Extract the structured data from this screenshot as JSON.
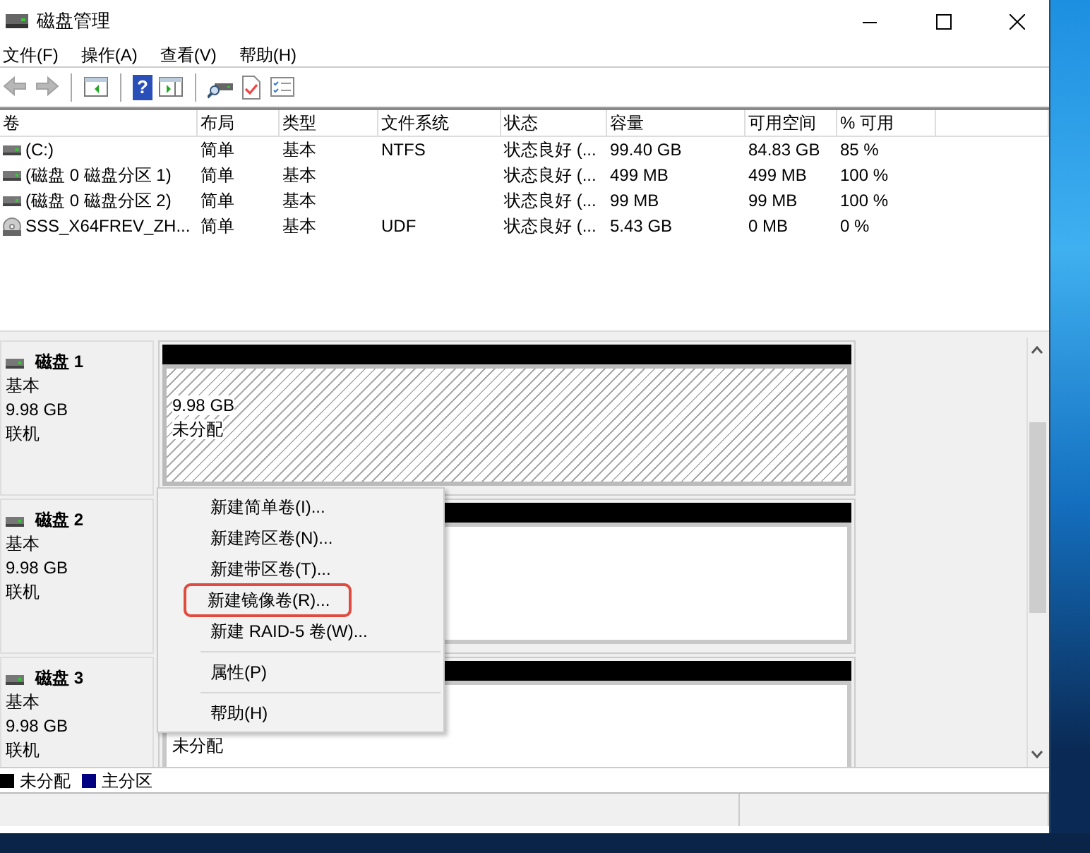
{
  "window": {
    "title": "磁盘管理"
  },
  "menu_bar": [
    "文件(F)",
    "操作(A)",
    "查看(V)",
    "帮助(H)"
  ],
  "toolbar": [
    {
      "kind": "back",
      "disabled": true
    },
    {
      "kind": "forward",
      "disabled": true
    },
    {
      "kind": "separator"
    },
    {
      "kind": "tree"
    },
    {
      "kind": "separator"
    },
    {
      "kind": "help",
      "glyph": "?"
    },
    {
      "kind": "pane"
    },
    {
      "kind": "separator"
    },
    {
      "kind": "connect"
    },
    {
      "kind": "doc"
    },
    {
      "kind": "list"
    }
  ],
  "volumes": {
    "columns": [
      "卷",
      "布局",
      "类型",
      "文件系统",
      "状态",
      "容量",
      "可用空间",
      "% 可用"
    ],
    "rows": [
      {
        "kind": "drive",
        "cells": [
          "(C:)",
          "简单",
          "基本",
          "NTFS",
          "状态良好 (...",
          "99.40 GB",
          "84.83 GB",
          "85 %"
        ]
      },
      {
        "kind": "drive",
        "cells": [
          "(磁盘 0 磁盘分区 1)",
          "简单",
          "基本",
          "",
          "状态良好 (...",
          "499 MB",
          "499 MB",
          "100 %"
        ]
      },
      {
        "kind": "drive",
        "cells": [
          "(磁盘 0 磁盘分区 2)",
          "简单",
          "基本",
          "",
          "状态良好 (...",
          "99 MB",
          "99 MB",
          "100 %"
        ]
      },
      {
        "kind": "disc",
        "cells": [
          "SSS_X64FREV_ZH...",
          "简单",
          "基本",
          "UDF",
          "状态良好 (...",
          "5.43 GB",
          "0 MB",
          "0 %"
        ]
      }
    ]
  },
  "disks": [
    {
      "name": "磁盘 1",
      "type": "基本",
      "size": "9.98 GB",
      "status": "联机",
      "partition": {
        "size": "9.98 GB",
        "label": "未分配",
        "selected": true
      }
    },
    {
      "name": "磁盘 2",
      "type": "基本",
      "size": "9.98 GB",
      "status": "联机",
      "partition": {
        "selected": false
      }
    },
    {
      "name": "磁盘 3",
      "type": "基本",
      "size": "9.98 GB",
      "status": "联机",
      "partition": {
        "label": "未分配",
        "selected": false
      }
    }
  ],
  "context_menu": [
    {
      "kind": "item",
      "label": "新建简单卷(I)...",
      "highlighted": false
    },
    {
      "kind": "item",
      "label": "新建跨区卷(N)...",
      "highlighted": false
    },
    {
      "kind": "item",
      "label": "新建带区卷(T)...",
      "highlighted": false
    },
    {
      "kind": "item",
      "label": "新建镜像卷(R)...",
      "highlighted": true
    },
    {
      "kind": "item",
      "label": "新建 RAID-5 卷(W)...",
      "highlighted": false
    },
    {
      "kind": "separator"
    },
    {
      "kind": "item",
      "label": "属性(P)",
      "highlighted": false
    },
    {
      "kind": "separator"
    },
    {
      "kind": "item",
      "label": "帮助(H)",
      "highlighted": false
    }
  ],
  "legend": [
    {
      "label": "未分配",
      "color": "#000000"
    },
    {
      "label": "主分区",
      "color": "#000080"
    }
  ]
}
